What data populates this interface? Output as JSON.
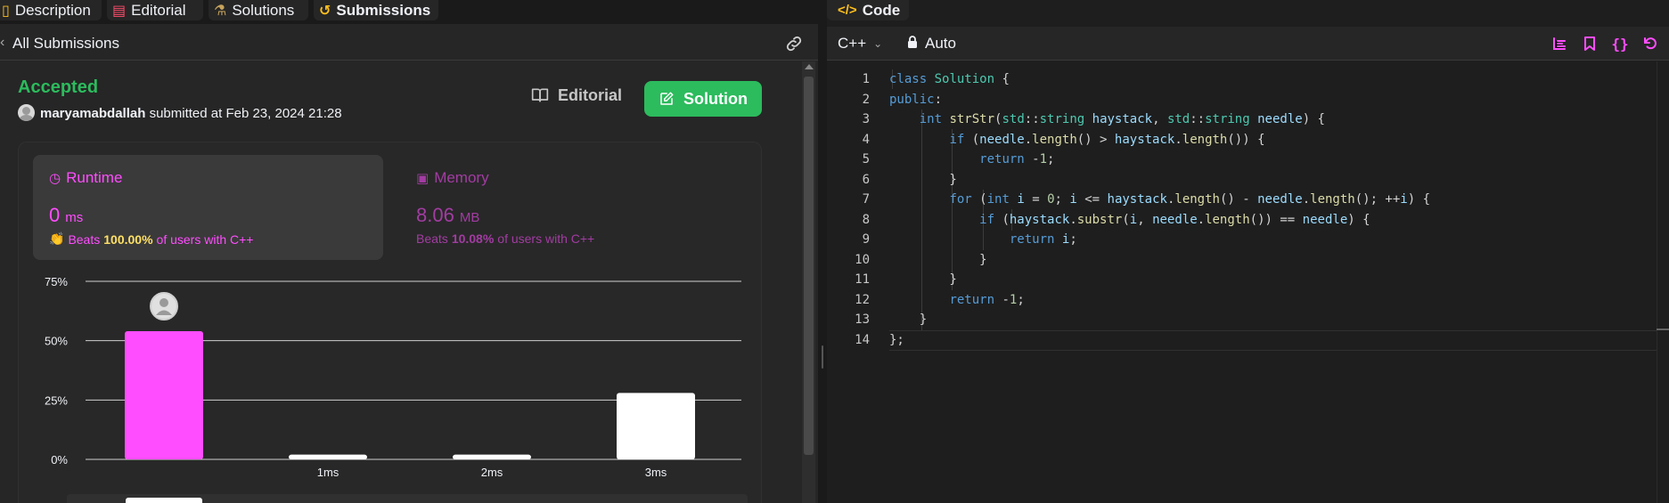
{
  "tabs": [
    {
      "label": "Description",
      "icon": "description-icon"
    },
    {
      "label": "Editorial",
      "icon": "book-icon"
    },
    {
      "label": "Solutions",
      "icon": "flask-icon"
    },
    {
      "label": "Submissions",
      "icon": "history-icon"
    }
  ],
  "submissions_header": {
    "title": "All Submissions"
  },
  "submission": {
    "status": "Accepted",
    "user": "maryamabdallah",
    "submitted_text": "submitted at Feb 23, 2024 21:28",
    "editorial_label": "Editorial",
    "solution_label": "Solution"
  },
  "stats": {
    "runtime": {
      "label": "Runtime",
      "value": "0",
      "unit": "ms",
      "beats_prefix": "Beats",
      "beats_value": "100.00%",
      "beats_suffix": "of users with C++"
    },
    "memory": {
      "label": "Memory",
      "value": "8.06",
      "unit": "MB",
      "beats_prefix": "Beats",
      "beats_value": "10.08%",
      "beats_suffix": "of users with C++"
    }
  },
  "chart_data": {
    "type": "bar",
    "categories": [
      "",
      "1ms",
      "2ms",
      "3ms"
    ],
    "values": [
      54,
      2,
      2,
      28
    ],
    "ylim": [
      0,
      75
    ],
    "yticks": [
      "0%",
      "25%",
      "50%",
      "75%"
    ],
    "grid": true,
    "highlight_index": 0,
    "colors": {
      "highlight": "#ff4dff",
      "normal": "#ffffff",
      "grid": "#cfcfcf",
      "label": "#eff1f6"
    }
  },
  "code_panel": {
    "tab_label": "Code",
    "language": "C++",
    "mode": "Auto",
    "line_numbers": [
      "1",
      "2",
      "3",
      "4",
      "5",
      "6",
      "7",
      "8",
      "9",
      "10",
      "11",
      "12",
      "13",
      "14"
    ]
  },
  "code_tokens": [
    [
      [
        "kw",
        "class"
      ],
      [
        "pl",
        " "
      ],
      [
        "ty",
        "Solution"
      ],
      [
        "pl",
        " {"
      ]
    ],
    [
      [
        "kw",
        "public"
      ],
      [
        "pl",
        ":"
      ]
    ],
    [
      [
        "pl",
        "    "
      ],
      [
        "kw",
        "int"
      ],
      [
        "pl",
        " "
      ],
      [
        "fn",
        "strStr"
      ],
      [
        "pl",
        "("
      ],
      [
        "ty",
        "std"
      ],
      [
        "pl",
        "::"
      ],
      [
        "ty",
        "string"
      ],
      [
        "pl",
        " "
      ],
      [
        "vr",
        "haystack"
      ],
      [
        "pl",
        ", "
      ],
      [
        "ty",
        "std"
      ],
      [
        "pl",
        "::"
      ],
      [
        "ty",
        "string"
      ],
      [
        "pl",
        " "
      ],
      [
        "vr",
        "needle"
      ],
      [
        "pl",
        ") {"
      ]
    ],
    [
      [
        "pl",
        "        "
      ],
      [
        "kw",
        "if"
      ],
      [
        "pl",
        " ("
      ],
      [
        "vr",
        "needle"
      ],
      [
        "pl",
        "."
      ],
      [
        "fn",
        "length"
      ],
      [
        "pl",
        "() > "
      ],
      [
        "vr",
        "haystack"
      ],
      [
        "pl",
        "."
      ],
      [
        "fn",
        "length"
      ],
      [
        "pl",
        "()) {"
      ]
    ],
    [
      [
        "pl",
        "            "
      ],
      [
        "kw",
        "return"
      ],
      [
        "pl",
        " -"
      ],
      [
        "num",
        "1"
      ],
      [
        "pl",
        ";"
      ]
    ],
    [
      [
        "pl",
        "        }"
      ]
    ],
    [
      [
        "pl",
        "        "
      ],
      [
        "kw",
        "for"
      ],
      [
        "pl",
        " ("
      ],
      [
        "kw",
        "int"
      ],
      [
        "pl",
        " "
      ],
      [
        "vr",
        "i"
      ],
      [
        "pl",
        " = "
      ],
      [
        "num",
        "0"
      ],
      [
        "pl",
        "; "
      ],
      [
        "vr",
        "i"
      ],
      [
        "pl",
        " <= "
      ],
      [
        "vr",
        "haystack"
      ],
      [
        "pl",
        "."
      ],
      [
        "fn",
        "length"
      ],
      [
        "pl",
        "() - "
      ],
      [
        "vr",
        "needle"
      ],
      [
        "pl",
        "."
      ],
      [
        "fn",
        "length"
      ],
      [
        "pl",
        "(); ++"
      ],
      [
        "vr",
        "i"
      ],
      [
        "pl",
        ") {"
      ]
    ],
    [
      [
        "pl",
        "            "
      ],
      [
        "kw",
        "if"
      ],
      [
        "pl",
        " ("
      ],
      [
        "vr",
        "haystack"
      ],
      [
        "pl",
        "."
      ],
      [
        "fn",
        "substr"
      ],
      [
        "pl",
        "("
      ],
      [
        "vr",
        "i"
      ],
      [
        "pl",
        ", "
      ],
      [
        "vr",
        "needle"
      ],
      [
        "pl",
        "."
      ],
      [
        "fn",
        "length"
      ],
      [
        "pl",
        "()) == "
      ],
      [
        "vr",
        "needle"
      ],
      [
        "pl",
        ") {"
      ]
    ],
    [
      [
        "pl",
        "                "
      ],
      [
        "kw",
        "return"
      ],
      [
        "pl",
        " "
      ],
      [
        "vr",
        "i"
      ],
      [
        "pl",
        ";"
      ]
    ],
    [
      [
        "pl",
        "            }"
      ]
    ],
    [
      [
        "pl",
        "        }"
      ]
    ],
    [
      [
        "pl",
        "        "
      ],
      [
        "kw",
        "return"
      ],
      [
        "pl",
        " -"
      ],
      [
        "num",
        "1"
      ],
      [
        "pl",
        ";"
      ]
    ],
    [
      [
        "pl",
        "    }"
      ]
    ],
    [
      [
        "pl",
        "};"
      ]
    ]
  ],
  "icons": {
    "link": "link-icon",
    "format": "format-icon",
    "bookmark": "bookmark-icon",
    "braces": "braces-icon",
    "reset": "reset-icon"
  },
  "accent_colors": {
    "green": "#2cbb5d",
    "pink": "#ff4dff",
    "yellow": "#ffc01e"
  }
}
